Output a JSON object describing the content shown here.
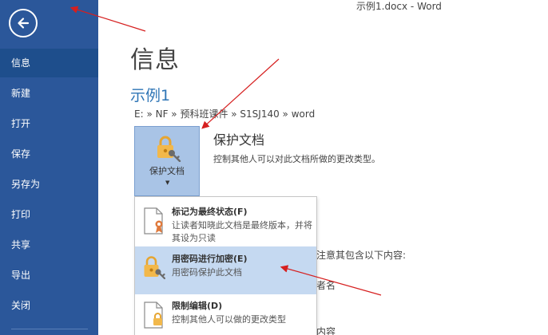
{
  "window": {
    "title": "示例1.docx - Word"
  },
  "sidebar": {
    "back_icon": "back-arrow-icon",
    "items": [
      {
        "label": "信息",
        "active": true
      },
      {
        "label": "新建"
      },
      {
        "label": "打开"
      },
      {
        "label": "保存"
      },
      {
        "label": "另存为"
      },
      {
        "label": "打印"
      },
      {
        "label": "共享"
      },
      {
        "label": "导出"
      },
      {
        "label": "关闭"
      }
    ]
  },
  "main": {
    "title": "信息",
    "doc_name": "示例1",
    "path": "E: » NF » 预科班课件 » S1SJ140 » word",
    "protect": {
      "button_label": "保护文档",
      "heading": "保护文档",
      "description": "控制其他人可以对此文档所做的更改类型。"
    },
    "background_texts": [
      "注意其包含以下内容:",
      "者名",
      "内容"
    ]
  },
  "dropdown": {
    "items": [
      {
        "title": "标记为最终状态(F)",
        "desc": "让读者知晓此文档是最终版本，并将其设为只读",
        "icon": "final-document-ribbon-icon"
      },
      {
        "title": "用密码进行加密(E)",
        "desc": "用密码保护此文档",
        "icon": "lock-key-icon",
        "hover": true
      },
      {
        "title": "限制编辑(D)",
        "desc": "控制其他人可以做的更改类型",
        "icon": "restrict-document-lock-icon"
      }
    ]
  },
  "colors": {
    "sidebar": "#2b579a",
    "sidebar_active": "#1e4e8c",
    "doc_name": "#2e75b6",
    "protect_button": "#a9c4e6",
    "menu_hover": "#c5d9f1",
    "annotation_arrow": "#d61f1f"
  }
}
